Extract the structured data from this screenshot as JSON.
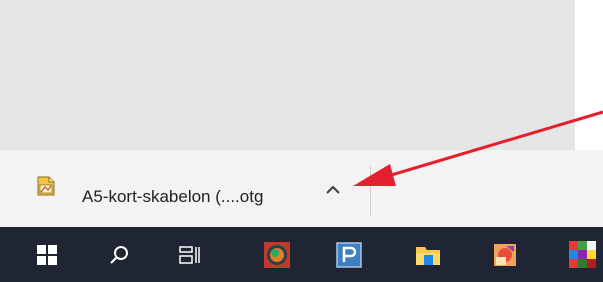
{
  "download_shelf": {
    "file_name": "A5-kort-skabelon (....otg",
    "file_icon": "libreoffice-draw-template-icon",
    "menu_icon": "chevron-up-icon"
  },
  "annotation": {
    "arrow_color": "#e5202e",
    "icon": "red-arrow"
  },
  "taskbar": {
    "background": "#1f2533",
    "items": [
      {
        "icon": "windows-start-icon"
      },
      {
        "icon": "search-icon"
      },
      {
        "icon": "task-view-icon"
      },
      {
        "icon": "app-round-icon"
      },
      {
        "icon": "app-p-icon"
      },
      {
        "icon": "file-explorer-icon"
      },
      {
        "icon": "app-globe-icon"
      },
      {
        "icon": "app-colorful-icon"
      }
    ]
  }
}
